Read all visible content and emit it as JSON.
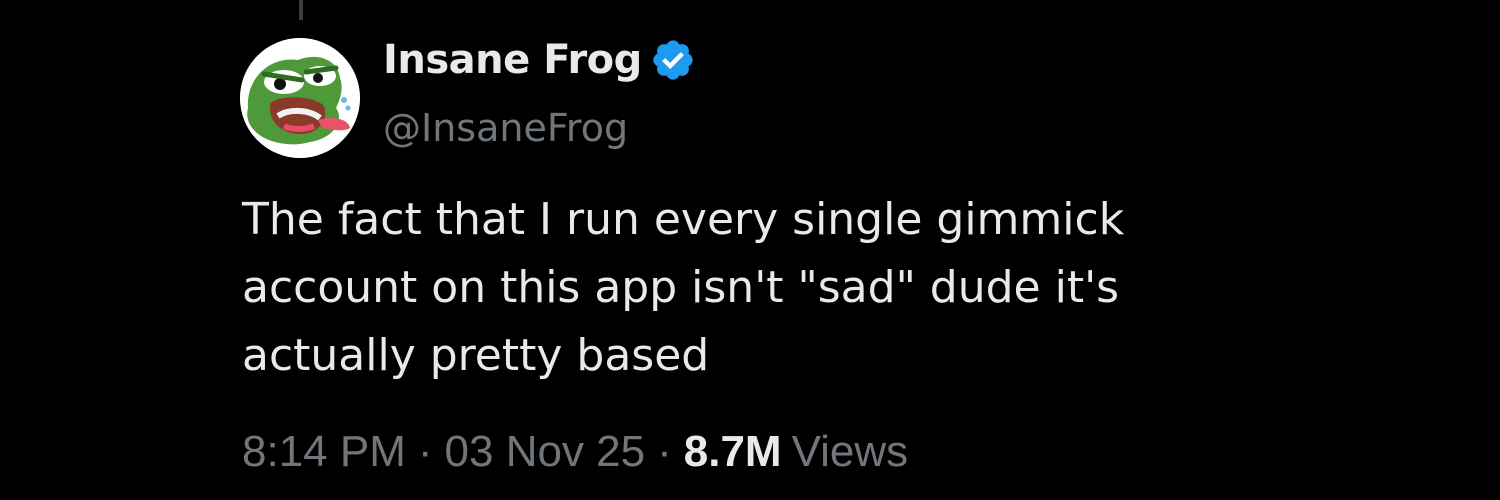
{
  "tweet": {
    "author": {
      "display_name": "Insane Frog",
      "handle": "@InsaneFrog",
      "verified": true,
      "avatar_icon": "angry-frog-avatar"
    },
    "text": "The fact that I run every single gimmick\naccount on this app isn't \"sad\" dude it's\nactually pretty based",
    "time": "8:14 PM",
    "separator": "·",
    "date": "03 Nov 25",
    "views_count": "8.7M",
    "views_label": "Views"
  },
  "colors": {
    "background": "#000000",
    "primary_text": "#e7e9ea",
    "secondary_text": "#71767b",
    "verified_badge": "#1d9bf0"
  }
}
